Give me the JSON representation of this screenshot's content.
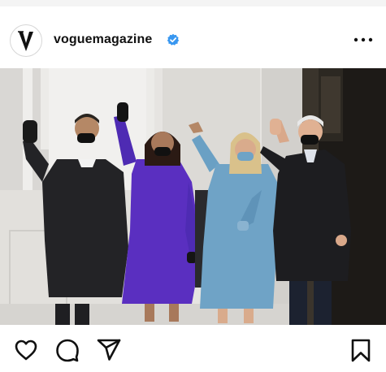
{
  "post": {
    "username": "voguemagazine",
    "avatar_icon": "vogue-v-logo-icon",
    "verified_icon": "verified-badge-icon",
    "verified_color": "#3897f0",
    "more_icon": "more-options-icon"
  },
  "actions": {
    "icons": [
      "heart-icon",
      "comment-icon",
      "share-icon",
      "bookmark-icon"
    ]
  },
  "colors": {
    "background": "#ffffff",
    "text": "#111111",
    "coat_purple": "#5a2fc0",
    "coat_blue": "#6fa3c6",
    "coat_black": "#1d1d1f"
  }
}
